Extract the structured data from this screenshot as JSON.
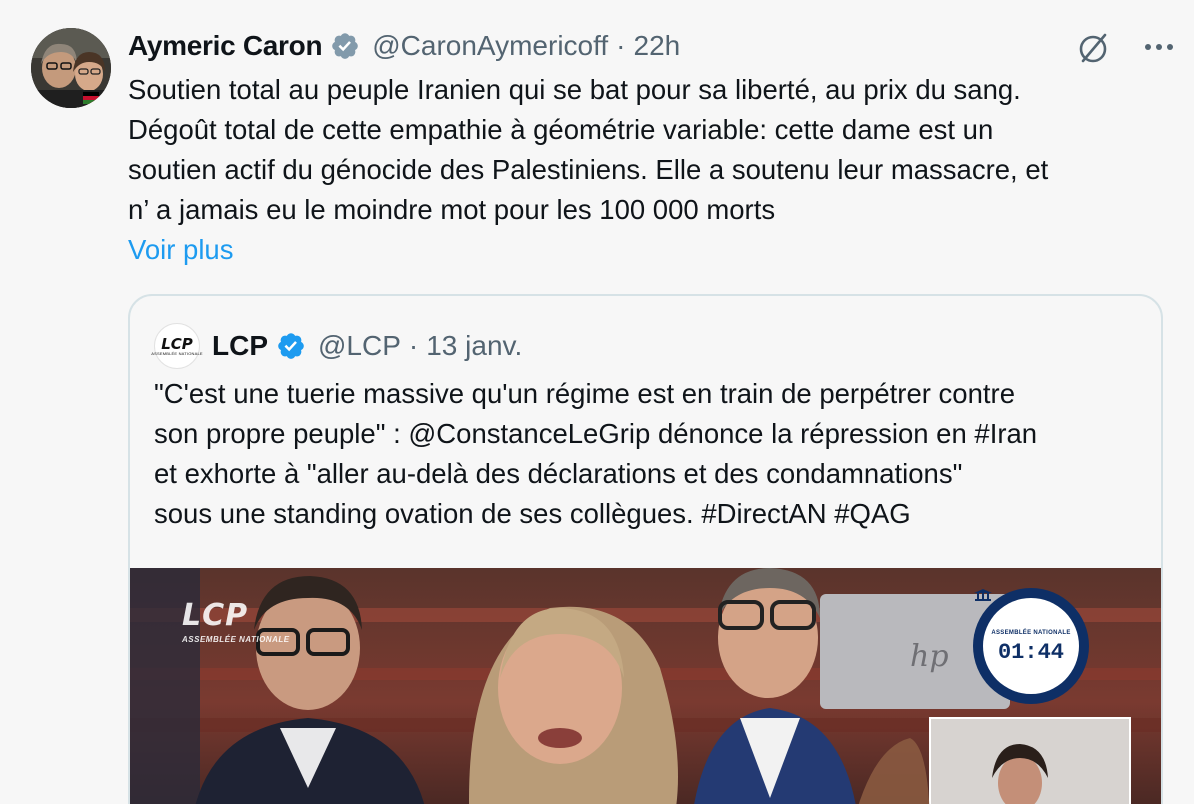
{
  "author": {
    "name": "Aymeric Caron",
    "handle": "@CaronAymericoff",
    "separator": "·",
    "time": "22h"
  },
  "tweet": {
    "lines": [
      "Soutien total au peuple Iranien qui se bat pour sa liberté, au prix du sang.",
      "Dégoût  total de cette empathie à géométrie variable: cette dame est un",
      "soutien actif du génocide des Palestiniens. Elle a soutenu leur massacre, et",
      "n’ a jamais eu le moindre mot pour les 100 000 morts"
    ],
    "show_more": "Voir plus"
  },
  "quote": {
    "logo_text": "LCP",
    "logo_subtext": "ASSEMBLÉE NATIONALE",
    "name": "LCP",
    "handle": "@LCP",
    "separator": "·",
    "date": "13 janv.",
    "lines": [
      "\"C'est une tuerie massive qu'un régime est en train de perpétrer contre",
      "son propre peuple\" : @ConstanceLeGrip dénonce la répression en #Iran",
      "et exhorte à \"aller au-delà des déclarations et des condamnations\"",
      "sous une standing ovation de ses collègues. #DirectAN #QAG"
    ],
    "media": {
      "watermark_title": "LCP",
      "watermark_subtitle": "ASSEMBLÉE NATIONALE",
      "timer_label": "ASSEMBLÉE NATIONALE",
      "timer": "01:44"
    }
  },
  "icons": {
    "verified": "verified-badge-icon",
    "grok": "slashed-circle-icon",
    "more": "more-dots-icon"
  },
  "colors": {
    "link": "#1d9bf0",
    "verified": "#1d9bf0",
    "secondary_text": "#536471",
    "background": "#f7f7f7"
  }
}
